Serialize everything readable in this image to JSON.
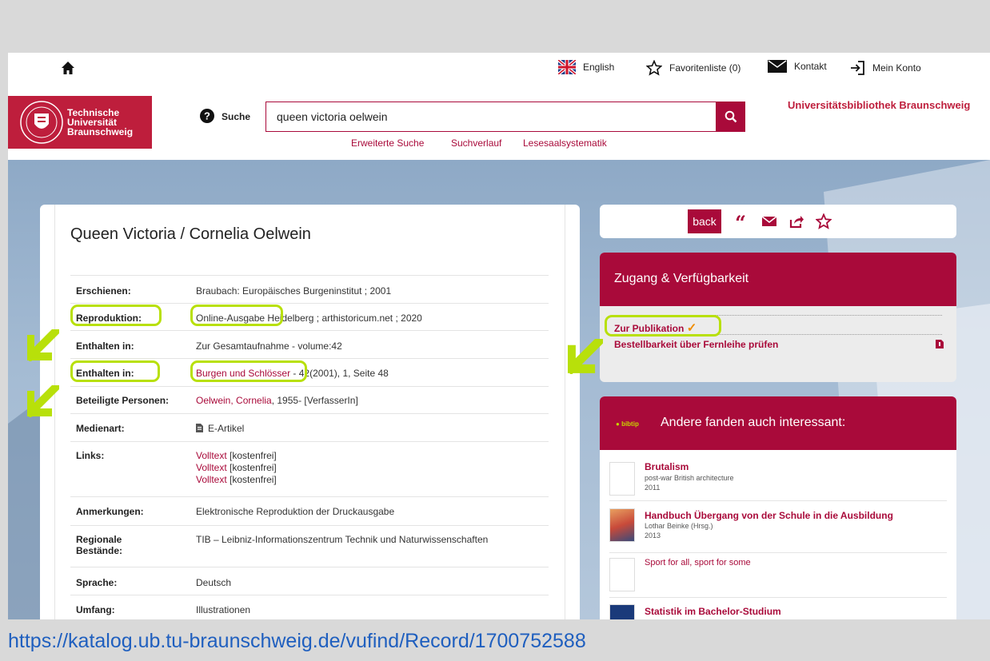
{
  "topbar": {
    "english": "English",
    "favorites": "Favoritenliste (0)",
    "contact": "Kontakt",
    "account": "Mein Konto"
  },
  "logo": {
    "line1": "Technische",
    "line2": "Universität",
    "line3": "Braunschweig"
  },
  "search": {
    "label": "Suche",
    "value": "queen victoria oelwein",
    "links": [
      "Erweiterte Suche",
      "Suchverlauf",
      "Lesesaalsystematik"
    ]
  },
  "library_title": "Universitätsbibliothek Braunschweig",
  "record": {
    "title": "Queen Victoria / Cornelia Oelwein",
    "rows": {
      "erschienen": {
        "label": "Erschienen:",
        "value": "Braubach: Europäisches Burgeninstitut ; 2001"
      },
      "reproduktion": {
        "label": "Reproduktion:",
        "value_a": "Online-Ausgabe",
        "value_b": "Heidelberg ; arthistoricum.net ; 2020"
      },
      "enthalten1": {
        "label": "Enthalten in:",
        "value": "Zur Gesamtaufnahme - volume:42"
      },
      "enthalten2": {
        "label": "Enthalten in:",
        "link": "Burgen und Schlösser",
        "value": "- 42(2001), 1, Seite 48"
      },
      "personen": {
        "label": "Beteiligte Personen:",
        "link": "Oelwein, Cornelia",
        "value": ", 1955- [VerfasserIn]"
      },
      "medienart": {
        "label": "Medienart:",
        "value": "E-Artikel"
      },
      "links": {
        "label": "Links:",
        "link": "Volltext",
        "note": "[kostenfrei]"
      },
      "anmerkungen": {
        "label": "Anmerkungen:",
        "value": "Elektronische Reproduktion der Druckausgabe"
      },
      "regionale": {
        "label_a": "Regionale",
        "label_b": "Bestände:",
        "link": "TIB – Leibniz-Informationszentrum Technik und Naturwissenschaften"
      },
      "sprache": {
        "label": "Sprache:",
        "value": "Deutsch"
      },
      "umfang": {
        "label": "Umfang:",
        "value": "Illustrationen"
      }
    }
  },
  "actions": {
    "back": "back"
  },
  "access": {
    "title": "Zugang & Verfügbarkeit",
    "publication": "Zur Publikation",
    "check": "✓",
    "interlibrary": "Bestellbarkeit über Fernleihe prüfen"
  },
  "reco": {
    "bibtip": "bibtip",
    "title": "Andere fanden auch interessant:",
    "items": [
      {
        "title": "Brutalism",
        "sub": "post-war British architecture",
        "year": "2011"
      },
      {
        "title": "Handbuch Übergang von der Schule in die Ausbildung",
        "sub": "Lothar Beinke (Hrsg.)",
        "year": "2013"
      },
      {
        "title": "Sport for all, sport for some"
      },
      {
        "title": "Statistik im Bachelor-Studium"
      }
    ]
  },
  "colors": {
    "accent": "#a90a3a",
    "tu_red": "#be1e3c",
    "highlight": "#b8e00a"
  },
  "url": "https://katalog.ub.tu-braunschweig.de/vufind/Record/1700752588"
}
